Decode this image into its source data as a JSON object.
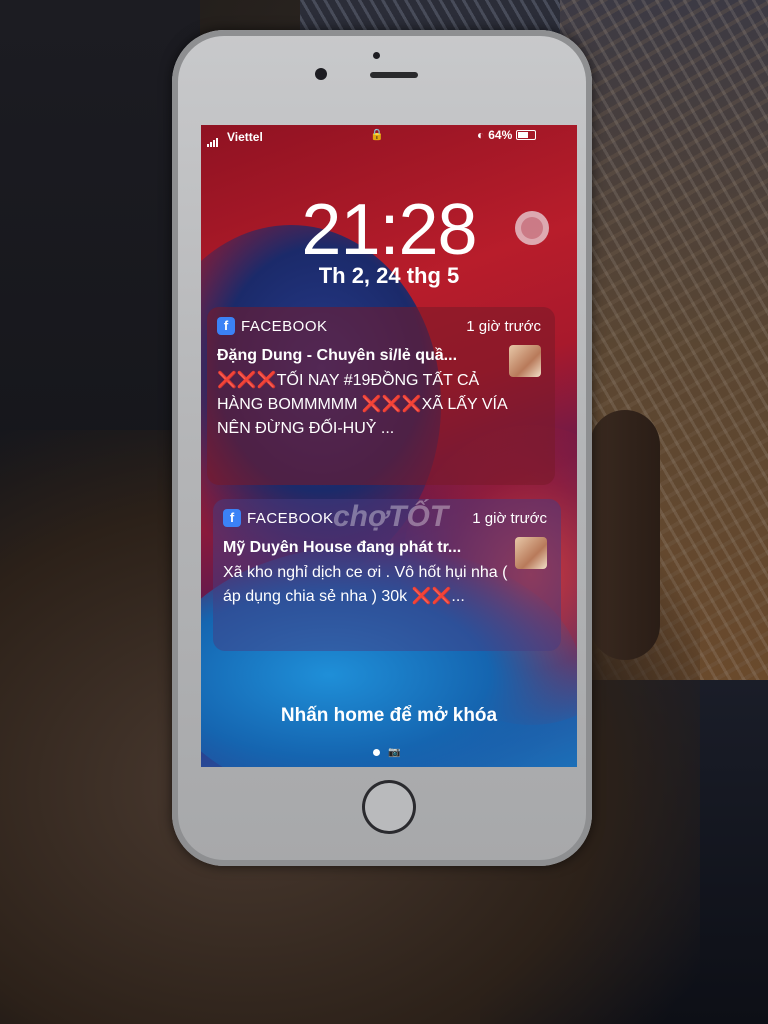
{
  "status_bar": {
    "carrier": "Viettel",
    "battery_text": "64%",
    "battery_level": 0.64
  },
  "lock_screen": {
    "time": "21:28",
    "date": "Th 2, 24 thg 5",
    "unlock_hint": "Nhấn home để mở khóa"
  },
  "notifications": [
    {
      "app": "FACEBOOK",
      "time": "1 giờ trước",
      "title": "Đặng Dung - Chuyên sỉ/lẻ quầ...",
      "body": "❌❌❌TỐI NAY #19ĐỒNG TẤT CẢ HÀNG BOMMMMM ❌❌❌XÃ LẤY VÍA NÊN ĐỪNG ĐỐI-HUỶ ..."
    },
    {
      "app": "FACEBOOK",
      "time": "1 giờ trước",
      "title": "Mỹ Duyên House đang phát tr...",
      "body": "Xã kho nghỉ dịch ce ơi . Vô hốt hụi nha ( áp dụng chia sẻ nha ) 30k ❌❌..."
    }
  ],
  "watermark": "chợTỐT",
  "icons": {
    "app_icon_glyph": "f",
    "lock": "🔒",
    "camera": "📷"
  }
}
